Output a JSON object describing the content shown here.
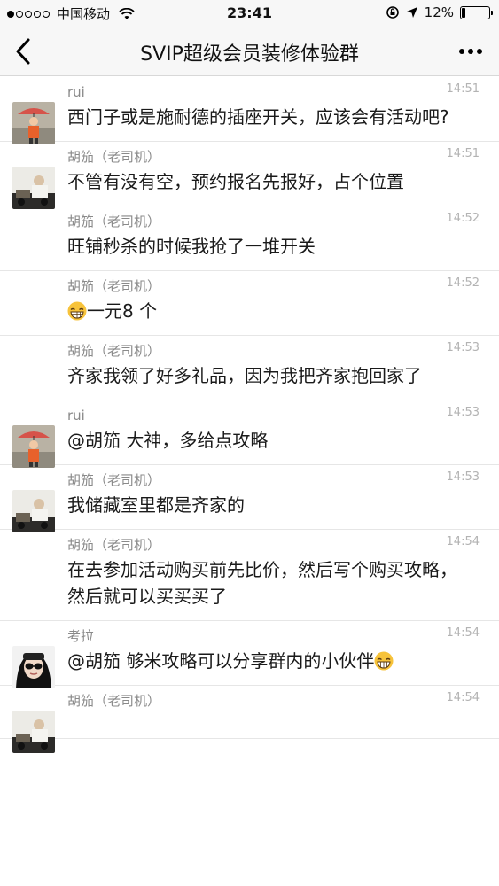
{
  "status_bar": {
    "carrier": "中国移动",
    "time": "23:41",
    "battery": "12%",
    "battery_level": 0.12,
    "icons": [
      "signal-dots",
      "wifi-icon",
      "lock-rotation-icon",
      "location-arrow-icon",
      "battery-icon"
    ]
  },
  "nav": {
    "title": "SVIP超级会员装修体验群",
    "back_icon": "chevron-left-icon",
    "more_icon": "more-dots-icon"
  },
  "messages": [
    {
      "sender": "rui",
      "time": "14:51",
      "text": "西门子或是施耐德的插座开关，应该会有活动吧?",
      "avatar": "rui"
    },
    {
      "sender": "胡笳（老司机）",
      "time": "14:51",
      "text": "不管有没有空，预约报名先报好，占个位置",
      "avatar": "hujia"
    },
    {
      "sender": "胡笳（老司机）",
      "time": "14:52",
      "text": "旺铺秒杀的时候我抢了一堆开关",
      "avatar": ""
    },
    {
      "sender": "胡笳（老司机）",
      "time": "14:52",
      "text": "一元8 个",
      "avatar": "",
      "lead_emoji": "grin-emoji"
    },
    {
      "sender": "胡笳（老司机）",
      "time": "14:53",
      "text": "齐家我领了好多礼品，因为我把齐家抱回家了",
      "avatar": ""
    },
    {
      "sender": "rui",
      "time": "14:53",
      "text": "@胡笳 大神，多给点攻略",
      "avatar": "rui"
    },
    {
      "sender": "胡笳（老司机）",
      "time": "14:53",
      "text": "我储藏室里都是齐家的",
      "avatar": "hujia"
    },
    {
      "sender": "胡笳（老司机）",
      "time": "14:54",
      "text": "在去参加活动购买前先比价，然后写个购买攻略，然后就可以买买买了",
      "avatar": ""
    },
    {
      "sender": "考拉",
      "time": "14:54",
      "text": "@胡笳 够米攻略可以分享群内的小伙伴",
      "avatar": "kaola",
      "trail_emoji": "grin-emoji"
    },
    {
      "sender": "胡笳（老司机）",
      "time": "14:54",
      "text": "",
      "avatar": "hujia"
    }
  ]
}
